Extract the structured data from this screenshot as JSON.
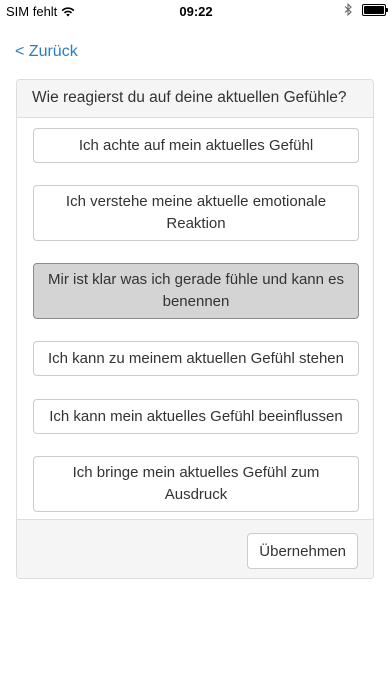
{
  "status_bar": {
    "carrier": "SIM fehlt",
    "time": "09:22",
    "icons": [
      "wifi-icon",
      "bluetooth-icon",
      "battery-icon"
    ]
  },
  "nav": {
    "back_label": "< Zurück"
  },
  "question": {
    "text": "Wie reagierst du auf deine aktuellen Gefühle?",
    "options": [
      {
        "label": "Ich achte auf mein aktuelles Gefühl",
        "selected": false
      },
      {
        "label": "Ich verstehe meine aktuelle emotionale Reaktion",
        "selected": false
      },
      {
        "label": "Mir ist klar was ich gerade fühle und kann es benennen",
        "selected": true
      },
      {
        "label": "Ich kann zu meinem aktuellen Gefühl stehen",
        "selected": false
      },
      {
        "label": "Ich kann mein aktuelles Gefühl beeinflussen",
        "selected": false
      },
      {
        "label": "Ich bringe mein aktuelles Gefühl zum Ausdruck",
        "selected": false
      }
    ]
  },
  "footer": {
    "submit_label": "Übernehmen"
  },
  "colors": {
    "link": "#2a7ec4",
    "panel_bg": "#f5f5f5",
    "selected_bg": "#d4d4d4"
  }
}
